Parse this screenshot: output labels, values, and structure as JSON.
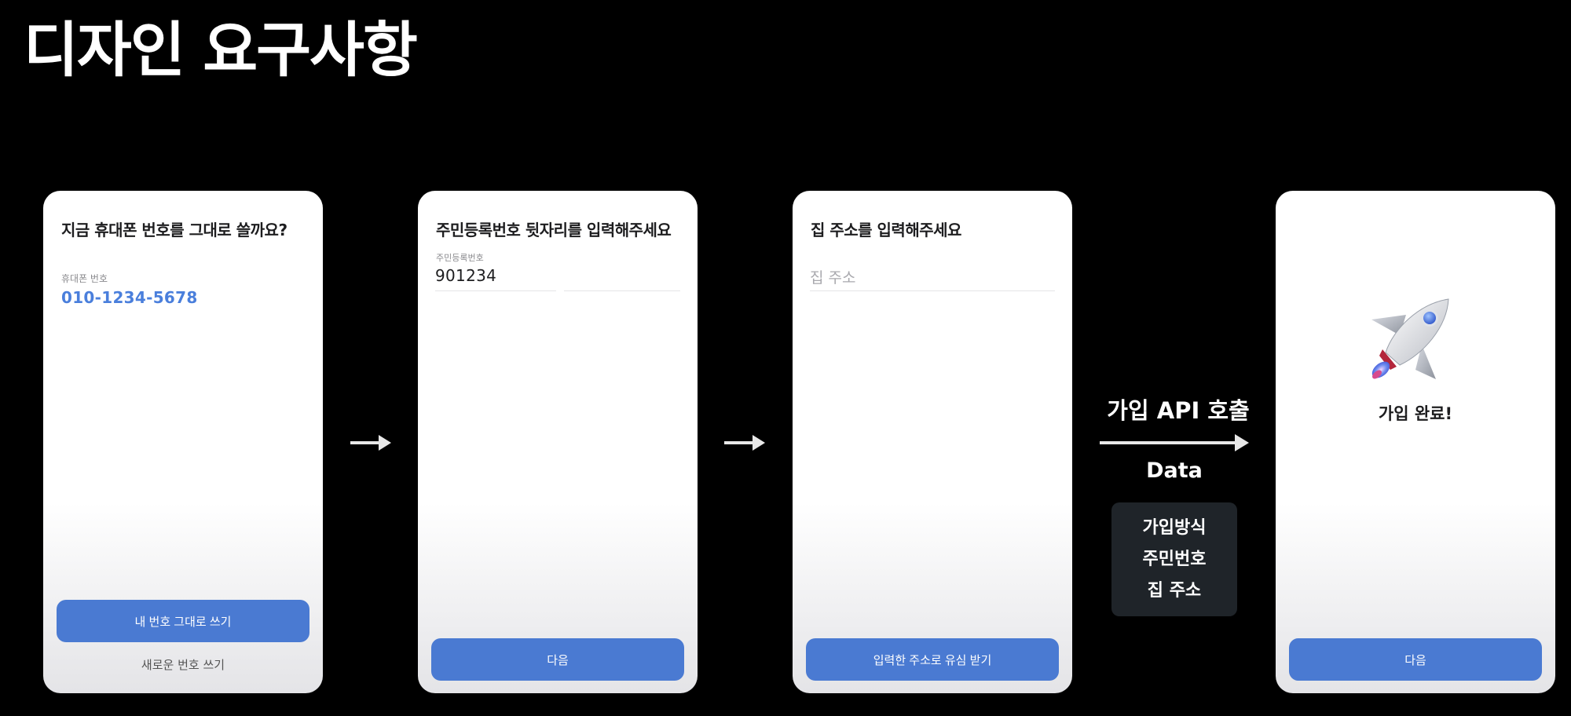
{
  "page_title": "디자인 요구사항",
  "screens": [
    {
      "title": "지금 휴대폰 번호를 그대로 쓸까요?",
      "field_label": "휴대폰 번호",
      "phone_number": "010-1234-5678",
      "primary_button": "내 번호 그대로 쓰기",
      "secondary_button": "새로운 번호 쓰기"
    },
    {
      "title": "주민등록번호 뒷자리를 입력해주세요",
      "field_label": "주민등록번호",
      "input_value": "901234",
      "primary_button": "다음"
    },
    {
      "title": "집 주소를 입력해주세요",
      "placeholder": "집 주소",
      "primary_button": "입력한 주소로 유심 받기"
    },
    {
      "complete_text": "가입 완료!",
      "primary_button": "다음"
    }
  ],
  "api": {
    "label": "가입 API 호출",
    "data_label": "Data",
    "data_items": [
      "가입방식",
      "주민번호",
      "집 주소"
    ]
  },
  "icons": {
    "arrow": "right-arrow-icon",
    "rocket": "rocket-icon"
  },
  "colors": {
    "accent": "#4a7ad2",
    "phone_number": "#4a7fdc",
    "data_box": "#1f2429"
  }
}
